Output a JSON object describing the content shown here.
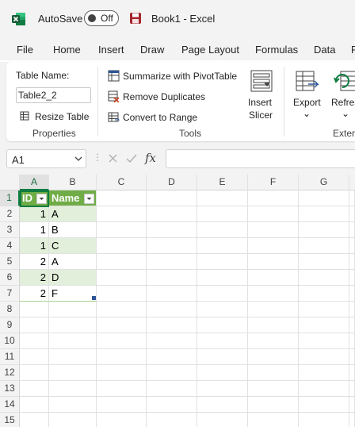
{
  "titlebar": {
    "app_icon": "excel-logo-icon",
    "autosave_label": "AutoSave",
    "autosave_state": "Off",
    "save_icon": "save-icon",
    "doc_title": "Book1  -  Excel"
  },
  "tabs": [
    "File",
    "Home",
    "Insert",
    "Draw",
    "Page Layout",
    "Formulas",
    "Data",
    "R"
  ],
  "ribbon": {
    "table_name_label": "Table Name:",
    "table_name_value": "Table2_2",
    "resize_table": "Resize Table",
    "properties_group": "Properties",
    "summarize_pivot": "Summarize with PivotTable",
    "remove_duplicates": "Remove Duplicates",
    "convert_to_range": "Convert to Range",
    "tools_group": "Tools",
    "insert_slicer_1": "Insert",
    "insert_slicer_2": "Slicer",
    "export": "Export",
    "refresh": "Refresh",
    "external_group": "Exter",
    "colors": {
      "accent": "#107c41",
      "pivot_icon": "#2b579a",
      "dup_icon": "#c43e1c"
    }
  },
  "formula_bar": {
    "name_box": "A1",
    "cancel_icon": "cancel-icon",
    "enter_icon": "checkmark-icon",
    "fx_label": "fx",
    "formula": ""
  },
  "grid": {
    "columns": [
      "A",
      "B",
      "C",
      "D",
      "E",
      "F",
      "G"
    ],
    "rows": [
      "1",
      "2",
      "3",
      "4",
      "5",
      "6",
      "7",
      "8",
      "9",
      "10",
      "11",
      "12",
      "13",
      "14",
      "15"
    ],
    "selected_cell": "A1",
    "table": {
      "headers": [
        "ID",
        "Name"
      ],
      "rows": [
        [
          "1",
          "A"
        ],
        [
          "1",
          "B"
        ],
        [
          "1",
          "C"
        ],
        [
          "2",
          "A"
        ],
        [
          "2",
          "D"
        ],
        [
          "2",
          "F"
        ]
      ],
      "colors": {
        "header": "#70ad47",
        "band": "#e2efda"
      }
    }
  }
}
